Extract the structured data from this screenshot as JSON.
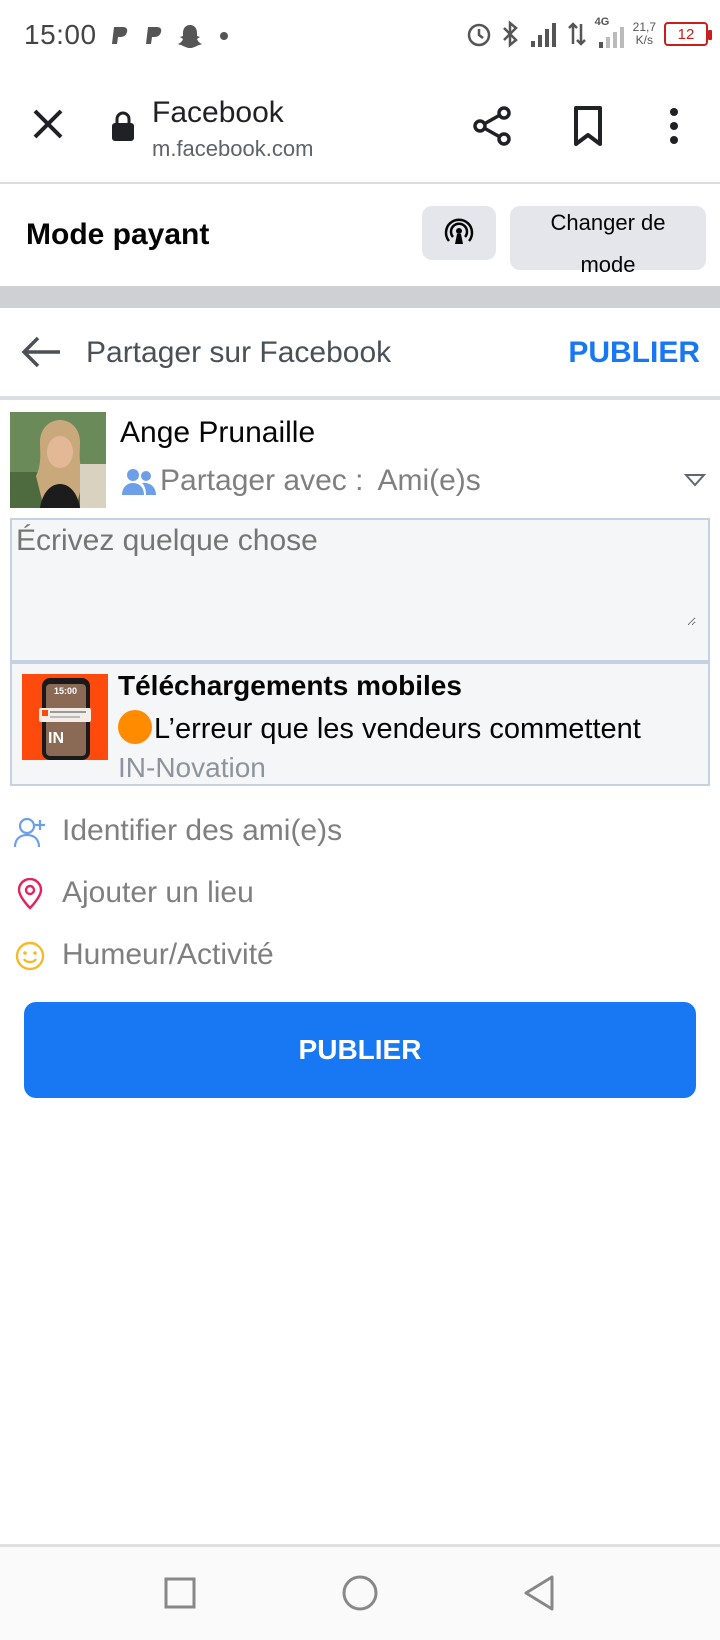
{
  "status_bar": {
    "time": "15:00",
    "network_speed_value": "21,7",
    "network_speed_unit": "K/s",
    "network_type": "4G",
    "battery": "12"
  },
  "browser": {
    "site_title": "Facebook",
    "url": "m.facebook.com"
  },
  "paid_mode": {
    "title": "Mode payant",
    "change_mode_label": "Changer de mode"
  },
  "share_header": {
    "title": "Partager sur Facebook",
    "publish_label": "PUBLIER"
  },
  "user": {
    "name": "Ange Prunaille",
    "share_with_label": "Partager avec :",
    "share_with_value": "Ami(e)s"
  },
  "compose": {
    "placeholder": "Écrivez quelque chose"
  },
  "link_preview": {
    "title": "Téléchargements mobiles",
    "description": "L’erreur que les vendeurs commettent",
    "source": "IN-Novation",
    "thumb_time": "15:00",
    "thumb_brand": "IN"
  },
  "options": [
    {
      "label": "Identifier des ami(e)s",
      "icon": "add-friend-icon",
      "color": "#1877f2"
    },
    {
      "label": "Ajouter un lieu",
      "icon": "location-pin-icon",
      "color": "#e0245e"
    },
    {
      "label": "Humeur/Activité",
      "icon": "smiley-icon",
      "color": "#f7b928"
    }
  ],
  "publish_button": "PUBLIER",
  "colors": {
    "accent": "#1877f2",
    "battery_low": "#c81e1e",
    "thumb_bg": "#ff4a0d"
  }
}
